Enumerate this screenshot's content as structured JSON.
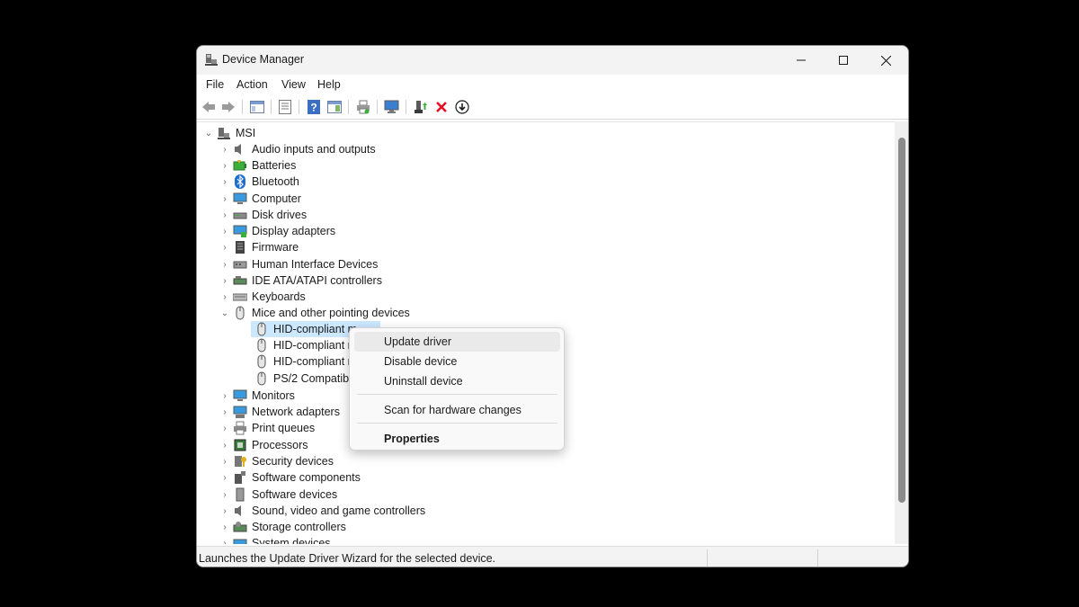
{
  "window": {
    "title": "Device Manager",
    "controls": {
      "minimize": "minimize",
      "maximize": "maximize",
      "close": "close"
    }
  },
  "menubar": [
    "File",
    "Action",
    "View",
    "Help"
  ],
  "toolbar": {
    "icons": [
      "back-arrow",
      "forward-arrow",
      "show-hide-console-tree",
      "properties",
      "help",
      "action-pane",
      "print",
      "scan-hardware",
      "update-driver",
      "uninstall",
      "disable-device"
    ]
  },
  "tree": {
    "root": "MSI",
    "categories": [
      {
        "label": "Audio inputs and outputs",
        "icon": "speaker-icon"
      },
      {
        "label": "Batteries",
        "icon": "battery-icon"
      },
      {
        "label": "Bluetooth",
        "icon": "bluetooth-icon"
      },
      {
        "label": "Computer",
        "icon": "computer-icon"
      },
      {
        "label": "Disk drives",
        "icon": "disk-icon"
      },
      {
        "label": "Display adapters",
        "icon": "display-adapter-icon"
      },
      {
        "label": "Firmware",
        "icon": "firmware-icon"
      },
      {
        "label": "Human Interface Devices",
        "icon": "hid-icon"
      },
      {
        "label": "IDE ATA/ATAPI controllers",
        "icon": "ide-icon"
      },
      {
        "label": "Keyboards",
        "icon": "keyboard-icon"
      },
      {
        "label": "Mice and other pointing devices",
        "icon": "mouse-icon",
        "expanded": true,
        "children": [
          "HID-compliant m",
          "HID-compliant m",
          "HID-compliant m",
          "PS/2 Compatible"
        ]
      },
      {
        "label": "Monitors",
        "icon": "monitor-icon"
      },
      {
        "label": "Network adapters",
        "icon": "network-icon"
      },
      {
        "label": "Print queues",
        "icon": "printer-icon"
      },
      {
        "label": "Processors",
        "icon": "processor-icon"
      },
      {
        "label": "Security devices",
        "icon": "security-icon"
      },
      {
        "label": "Software components",
        "icon": "software-component-icon"
      },
      {
        "label": "Software devices",
        "icon": "software-device-icon"
      },
      {
        "label": "Sound, video and game controllers",
        "icon": "sound-icon"
      },
      {
        "label": "Storage controllers",
        "icon": "storage-icon"
      },
      {
        "label": "System devices",
        "icon": "system-icon"
      }
    ]
  },
  "context_menu": {
    "items": [
      "Update driver",
      "Disable device",
      "Uninstall device"
    ],
    "scan": "Scan for hardware changes",
    "properties": "Properties"
  },
  "status": "Launches the Update Driver Wizard for the selected device.",
  "colors": {
    "selection": "#cce8ff",
    "uninstall_red": "#e81123"
  }
}
